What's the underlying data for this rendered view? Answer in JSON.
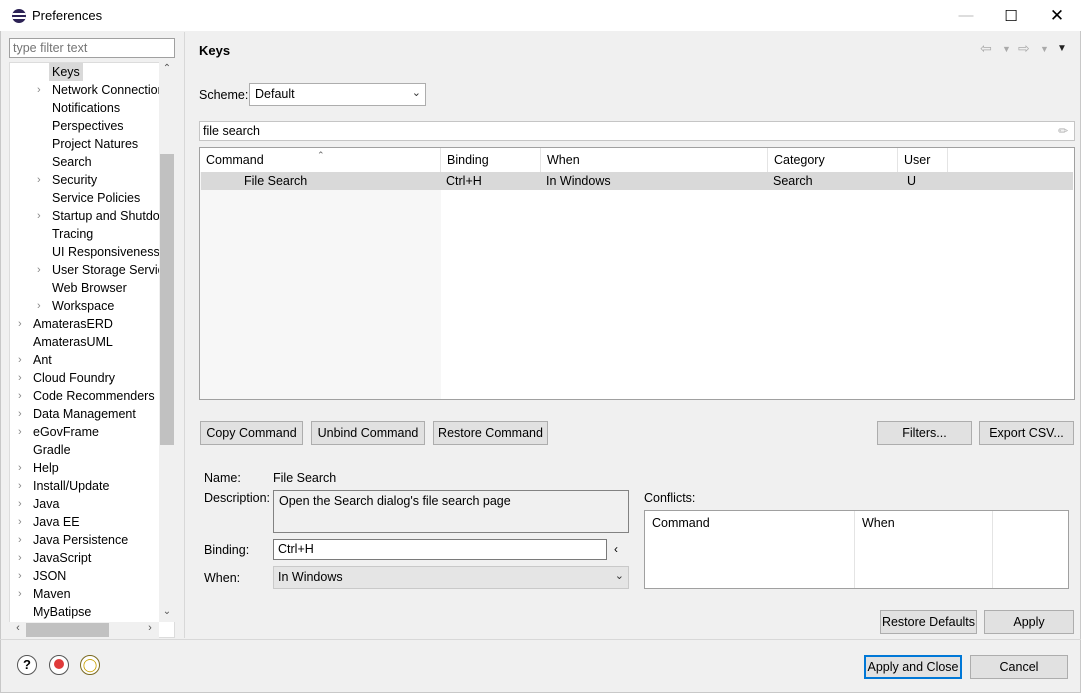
{
  "window": {
    "title": "Preferences",
    "controls": {
      "minimize": "—",
      "maximize": "☐",
      "close": "✕"
    }
  },
  "filter": {
    "placeholder": "type filter text"
  },
  "tree": {
    "items": [
      {
        "label": "Keys",
        "level": 2,
        "expandable": false,
        "selected": true
      },
      {
        "label": "Network Connections",
        "level": 2,
        "expandable": true
      },
      {
        "label": "Notifications",
        "level": 2,
        "expandable": false
      },
      {
        "label": "Perspectives",
        "level": 2,
        "expandable": false
      },
      {
        "label": "Project Natures",
        "level": 2,
        "expandable": false
      },
      {
        "label": "Search",
        "level": 2,
        "expandable": false
      },
      {
        "label": "Security",
        "level": 2,
        "expandable": true
      },
      {
        "label": "Service Policies",
        "level": 2,
        "expandable": false
      },
      {
        "label": "Startup and Shutdown",
        "level": 2,
        "expandable": true
      },
      {
        "label": "Tracing",
        "level": 2,
        "expandable": false
      },
      {
        "label": "UI Responsiveness Monitoring",
        "level": 2,
        "expandable": false
      },
      {
        "label": "User Storage Service",
        "level": 2,
        "expandable": true
      },
      {
        "label": "Web Browser",
        "level": 2,
        "expandable": false
      },
      {
        "label": "Workspace",
        "level": 2,
        "expandable": true
      },
      {
        "label": "AmaterasERD",
        "level": 1,
        "expandable": true
      },
      {
        "label": "AmaterasUML",
        "level": 1,
        "expandable": false
      },
      {
        "label": "Ant",
        "level": 1,
        "expandable": true
      },
      {
        "label": "Cloud Foundry",
        "level": 1,
        "expandable": true
      },
      {
        "label": "Code Recommenders",
        "level": 1,
        "expandable": true
      },
      {
        "label": "Data Management",
        "level": 1,
        "expandable": true
      },
      {
        "label": "eGovFrame",
        "level": 1,
        "expandable": true
      },
      {
        "label": "Gradle",
        "level": 1,
        "expandable": false
      },
      {
        "label": "Help",
        "level": 1,
        "expandable": true
      },
      {
        "label": "Install/Update",
        "level": 1,
        "expandable": true
      },
      {
        "label": "Java",
        "level": 1,
        "expandable": true
      },
      {
        "label": "Java EE",
        "level": 1,
        "expandable": true
      },
      {
        "label": "Java Persistence",
        "level": 1,
        "expandable": true
      },
      {
        "label": "JavaScript",
        "level": 1,
        "expandable": true
      },
      {
        "label": "JSON",
        "level": 1,
        "expandable": true
      },
      {
        "label": "Maven",
        "level": 1,
        "expandable": true
      },
      {
        "label": "MyBatipse",
        "level": 1,
        "expandable": false
      }
    ]
  },
  "page": {
    "title": "Keys"
  },
  "scheme": {
    "label": "Scheme:",
    "value": "Default"
  },
  "search": {
    "value": "file search"
  },
  "table": {
    "headers": [
      "Command",
      "Binding",
      "When",
      "Category",
      "User"
    ],
    "rows": [
      {
        "command": "File Search",
        "binding": "Ctrl+H",
        "when": "In Windows",
        "category": "Search",
        "user": "U"
      }
    ]
  },
  "buttons": {
    "copy": "Copy Command",
    "unbind": "Unbind Command",
    "restore_command": "Restore Command",
    "filters": "Filters...",
    "export": "Export CSV...",
    "restore_defaults": "Restore Defaults",
    "apply": "Apply",
    "apply_close": "Apply and Close",
    "cancel": "Cancel"
  },
  "details": {
    "name_label": "Name:",
    "name_value": "File Search",
    "description_label": "Description:",
    "description_value": "Open the Search dialog's file search page",
    "binding_label": "Binding:",
    "binding_value": "Ctrl+H",
    "when_label": "When:",
    "when_value": "In Windows"
  },
  "conflicts": {
    "label": "Conflicts:",
    "headers": [
      "Command",
      "When"
    ]
  },
  "colors": {
    "selection": "#d9d9d9",
    "default_button_border": "#0078d7"
  },
  "icons": [
    "help-icon",
    "record-macro-icon",
    "tip-icon"
  ]
}
